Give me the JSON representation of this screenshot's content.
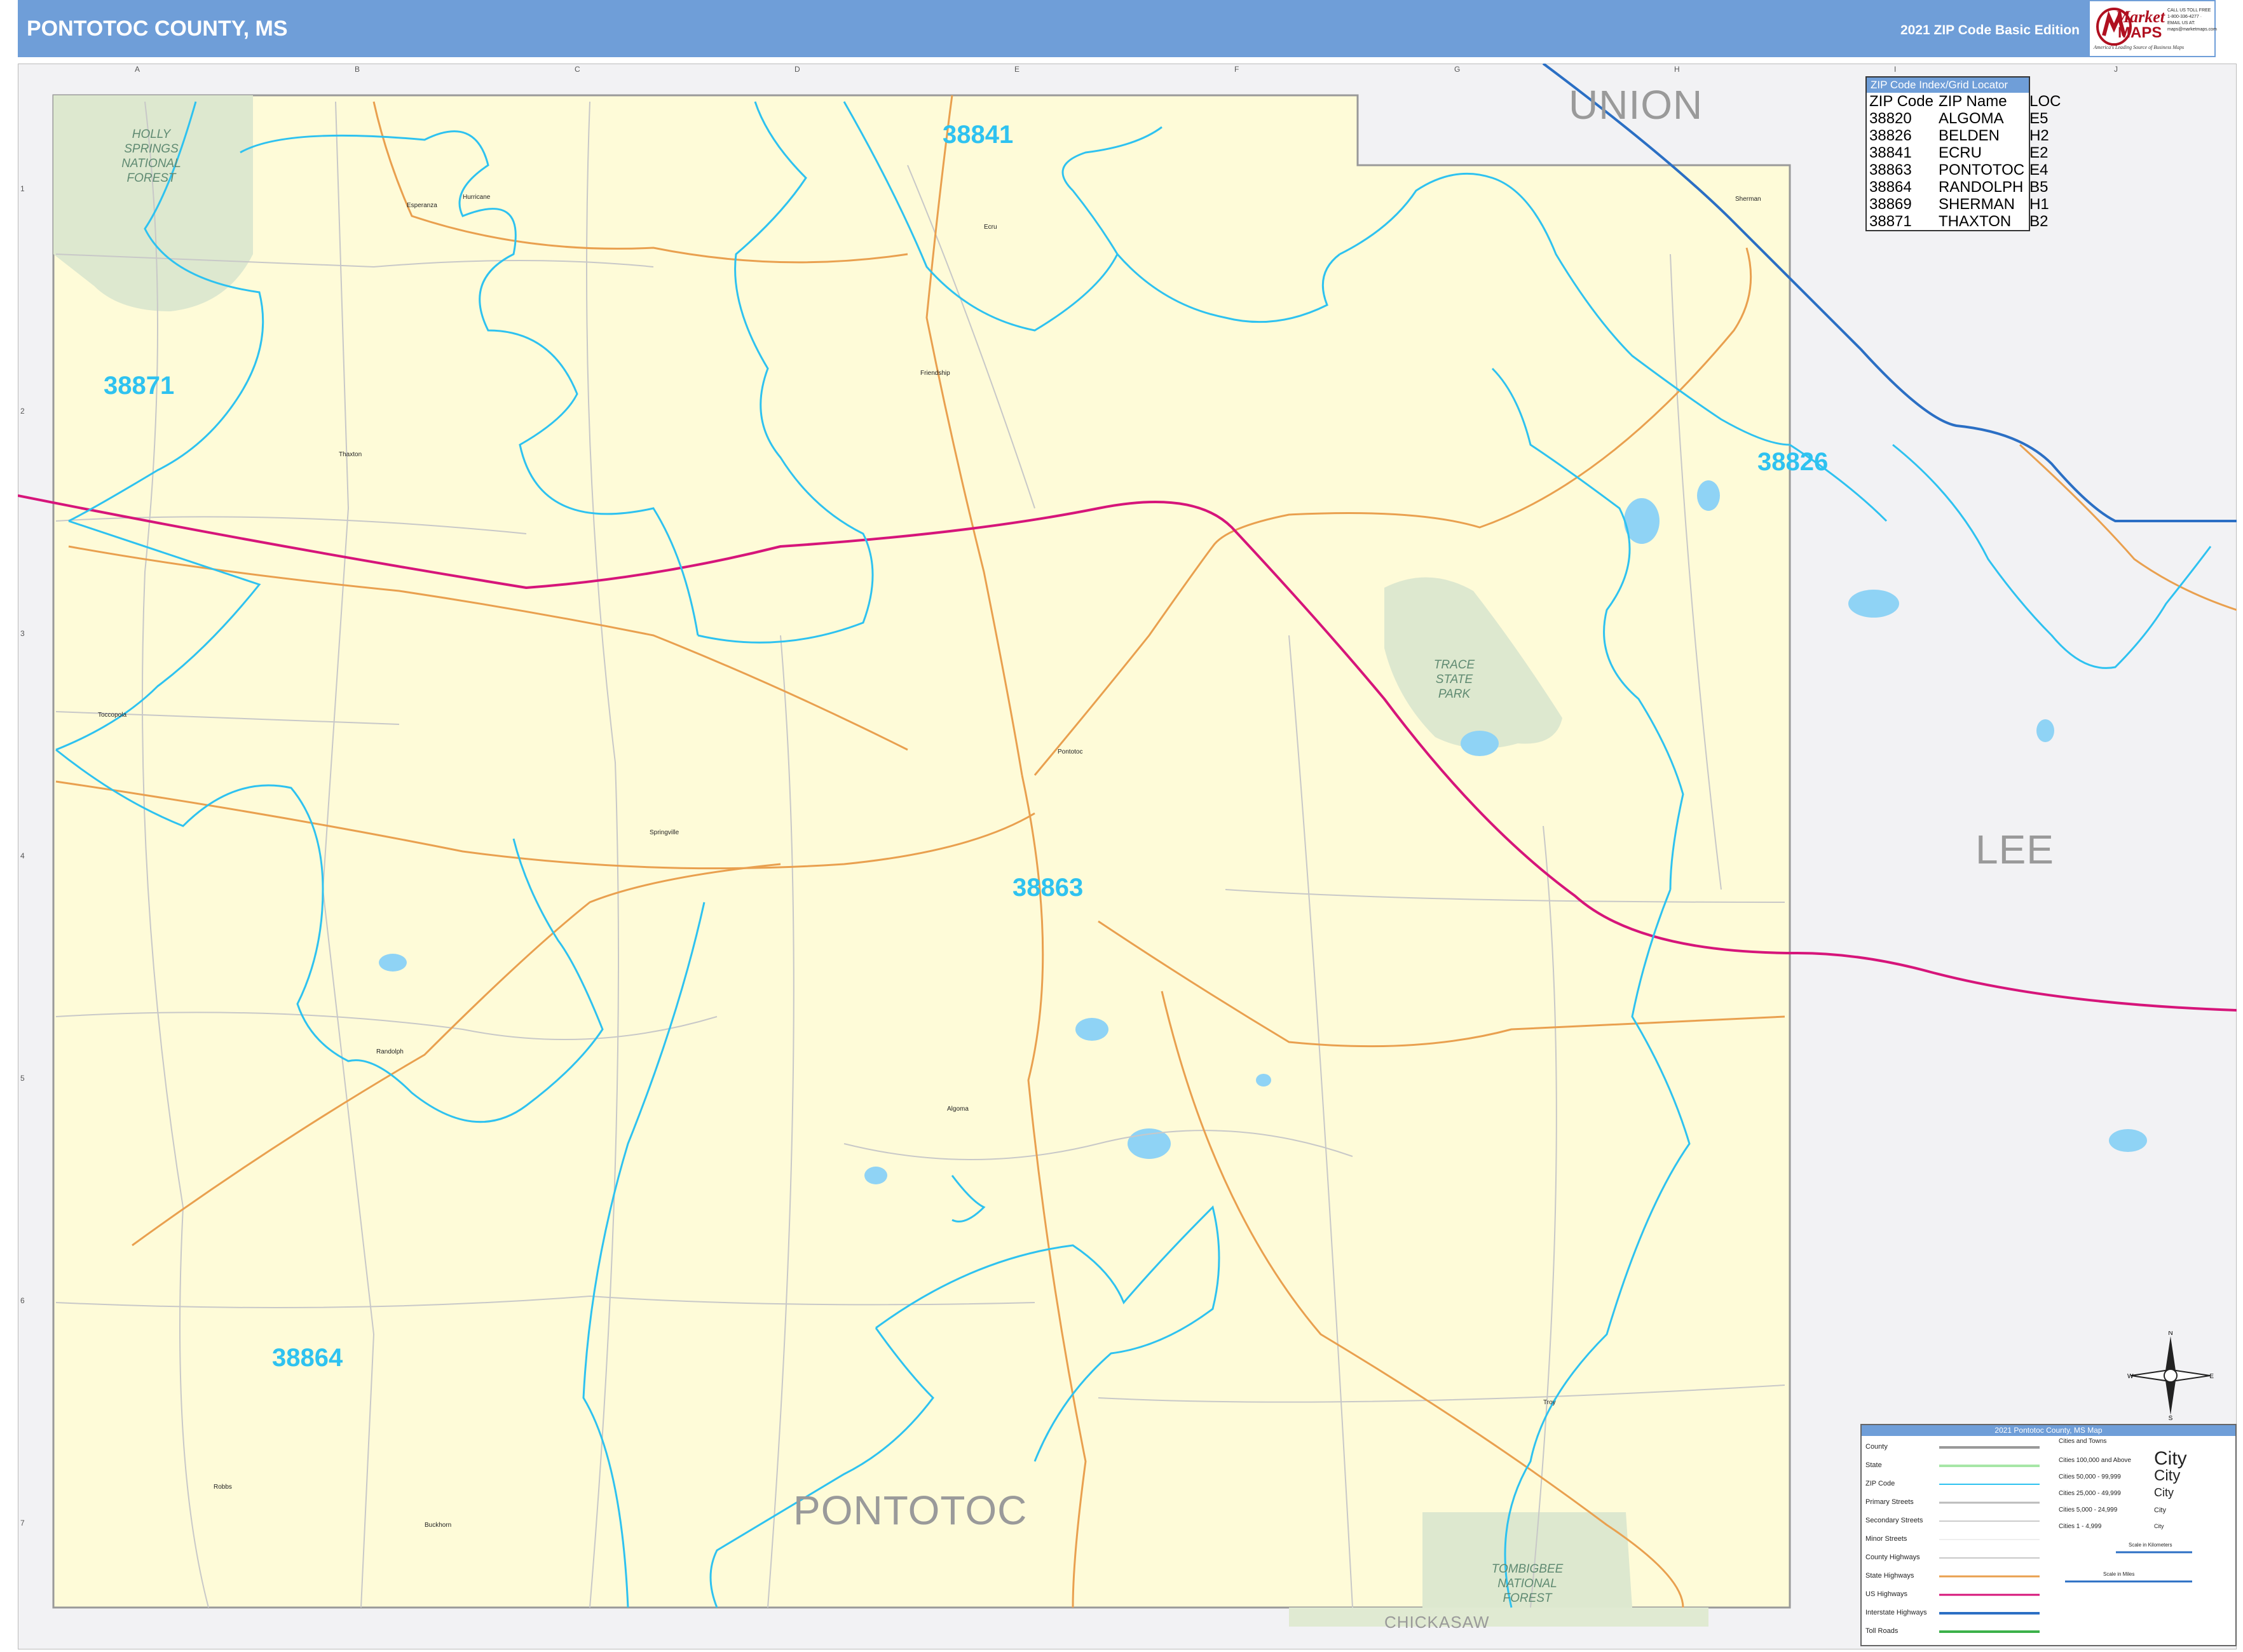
{
  "header": {
    "title": "PONTOTOC COUNTY, MS",
    "edition": "2021 ZIP Code Basic Edition"
  },
  "brand": {
    "name_top": "Market",
    "name_bottom": "MAPS",
    "tagline": "America's Leading Source of Business Maps",
    "contact": "CALL US TOLL FREE 1-800-336-4277 · EMAIL US AT: maps@marketmaps.com"
  },
  "grid": {
    "columns": [
      "A",
      "B",
      "C",
      "D",
      "E",
      "F",
      "G",
      "H",
      "I",
      "J"
    ],
    "rows": [
      "1",
      "2",
      "3",
      "4",
      "5",
      "6",
      "7"
    ]
  },
  "regions": {
    "union": "UNION",
    "lee": "LEE",
    "pontotoc": "PONTOTOC",
    "chickasaw": "CHICKASAW"
  },
  "parks": {
    "holly_springs": [
      "HOLLY",
      "SPRINGS",
      "NATIONAL",
      "FOREST"
    ],
    "trace": [
      "TRACE",
      "STATE",
      "PARK"
    ],
    "tombigbee": [
      "TOMBIGBEE",
      "NATIONAL",
      "FOREST"
    ]
  },
  "zip_labels": {
    "z38841": "38841",
    "z38871": "38871",
    "z38826": "38826",
    "z38863": "38863",
    "z38864": "38864"
  },
  "towns": {
    "esperanza": "Esperanza",
    "hurricane": "Hurricane",
    "ecru": "Ecru",
    "friendship": "Friendship",
    "thaxton": "Thaxton",
    "toccopola": "Toccopola",
    "springville": "Springville",
    "pontotoc": "Pontotoc",
    "randolph": "Randolph",
    "algoma": "Algoma",
    "robbs": "Robbs",
    "buckhorn": "Buckhorn",
    "troy": "Troy",
    "sherman": "Sherman"
  },
  "zip_index": {
    "title": "ZIP Code Index/Grid Locator",
    "headers": [
      "ZIP Code",
      "ZIP Name",
      "LOC"
    ],
    "rows": [
      [
        "38820",
        "ALGOMA",
        "E5"
      ],
      [
        "38826",
        "BELDEN",
        "H2"
      ],
      [
        "38841",
        "ECRU",
        "E2"
      ],
      [
        "38863",
        "PONTOTOC",
        "E4"
      ],
      [
        "38864",
        "RANDOLPH",
        "B5"
      ],
      [
        "38869",
        "SHERMAN",
        "H1"
      ],
      [
        "38871",
        "THAXTON",
        "B2"
      ]
    ]
  },
  "legend": {
    "title": "2021 Pontotoc County, MS Map",
    "items": [
      "County",
      "State",
      "ZIP Code",
      "Primary Streets",
      "Secondary Streets",
      "Minor Streets",
      "County Highways",
      "State Highways",
      "US Highways",
      "Interstate Highways",
      "Toll Roads"
    ],
    "cities_title": "Cities and Towns",
    "cities": [
      {
        "range": "Cities 100,000 and Above",
        "sample": "City"
      },
      {
        "range": "Cities 50,000 - 99,999",
        "sample": "City"
      },
      {
        "range": "Cities 25,000 - 49,999",
        "sample": "City"
      },
      {
        "range": "Cities 5,000 - 24,999",
        "sample": "City"
      },
      {
        "range": "Cities 1 - 4,999",
        "sample": "City"
      }
    ],
    "scale_km": "Scale in Kilometers",
    "scale_mi": "Scale in Miles"
  },
  "compass": {
    "n": "N",
    "s": "S",
    "e": "E",
    "w": "W"
  },
  "colors": {
    "header_bar": "#6f9ed8",
    "county_fill": "#fefbd8",
    "outside_fill": "#f2f2f4",
    "zip_boundary": "#2ec2f0",
    "us_highway": "#d6157a",
    "state_highway": "#e9a04f",
    "interstate": "#2b6fc4",
    "park_fill": "#dde8cf",
    "water": "#8fd3f5",
    "zip_label": "#2ec2f0"
  }
}
